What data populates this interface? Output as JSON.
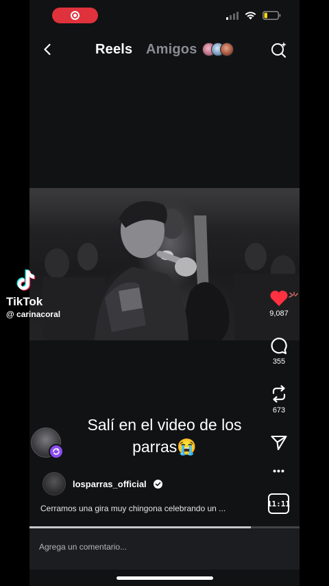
{
  "status_bar": {
    "recording_icon": "screen-record-icon",
    "signal_icon": "cellular-signal-icon",
    "wifi_icon": "wifi-icon",
    "battery_icon": "battery-low-icon",
    "recording_color": "#e0323c",
    "battery_color": "#f5d90a"
  },
  "nav": {
    "back_icon": "chevron-left-icon",
    "tabs": [
      {
        "label": "Reels",
        "active": true
      },
      {
        "label": "Amigos",
        "active": false
      }
    ],
    "friends_avatars_icon": "friends-avatars-icon",
    "camera_icon": "camera-sparkle-icon"
  },
  "watermark": {
    "brand": "TikTok",
    "username": "@ carinacoral"
  },
  "actions": {
    "like": {
      "icon": "heart-icon",
      "count": "9,087",
      "color": "#ff3040"
    },
    "comment": {
      "icon": "comment-bubble-icon",
      "count": "355"
    },
    "repost": {
      "icon": "repost-icon",
      "count": "673"
    },
    "share": {
      "icon": "paper-plane-icon"
    },
    "more": {
      "icon": "more-horizontal-icon",
      "label": "•••"
    }
  },
  "overlay": {
    "text": "Salí en el video de los parras😭"
  },
  "post": {
    "author": "losparras_official",
    "verified": true,
    "caption": "Cerramos una gira muy chingona celebrando un ...",
    "audio_badge": "11:11",
    "progress": 0.82
  },
  "comment": {
    "placeholder": "Agrega un comentario..."
  }
}
